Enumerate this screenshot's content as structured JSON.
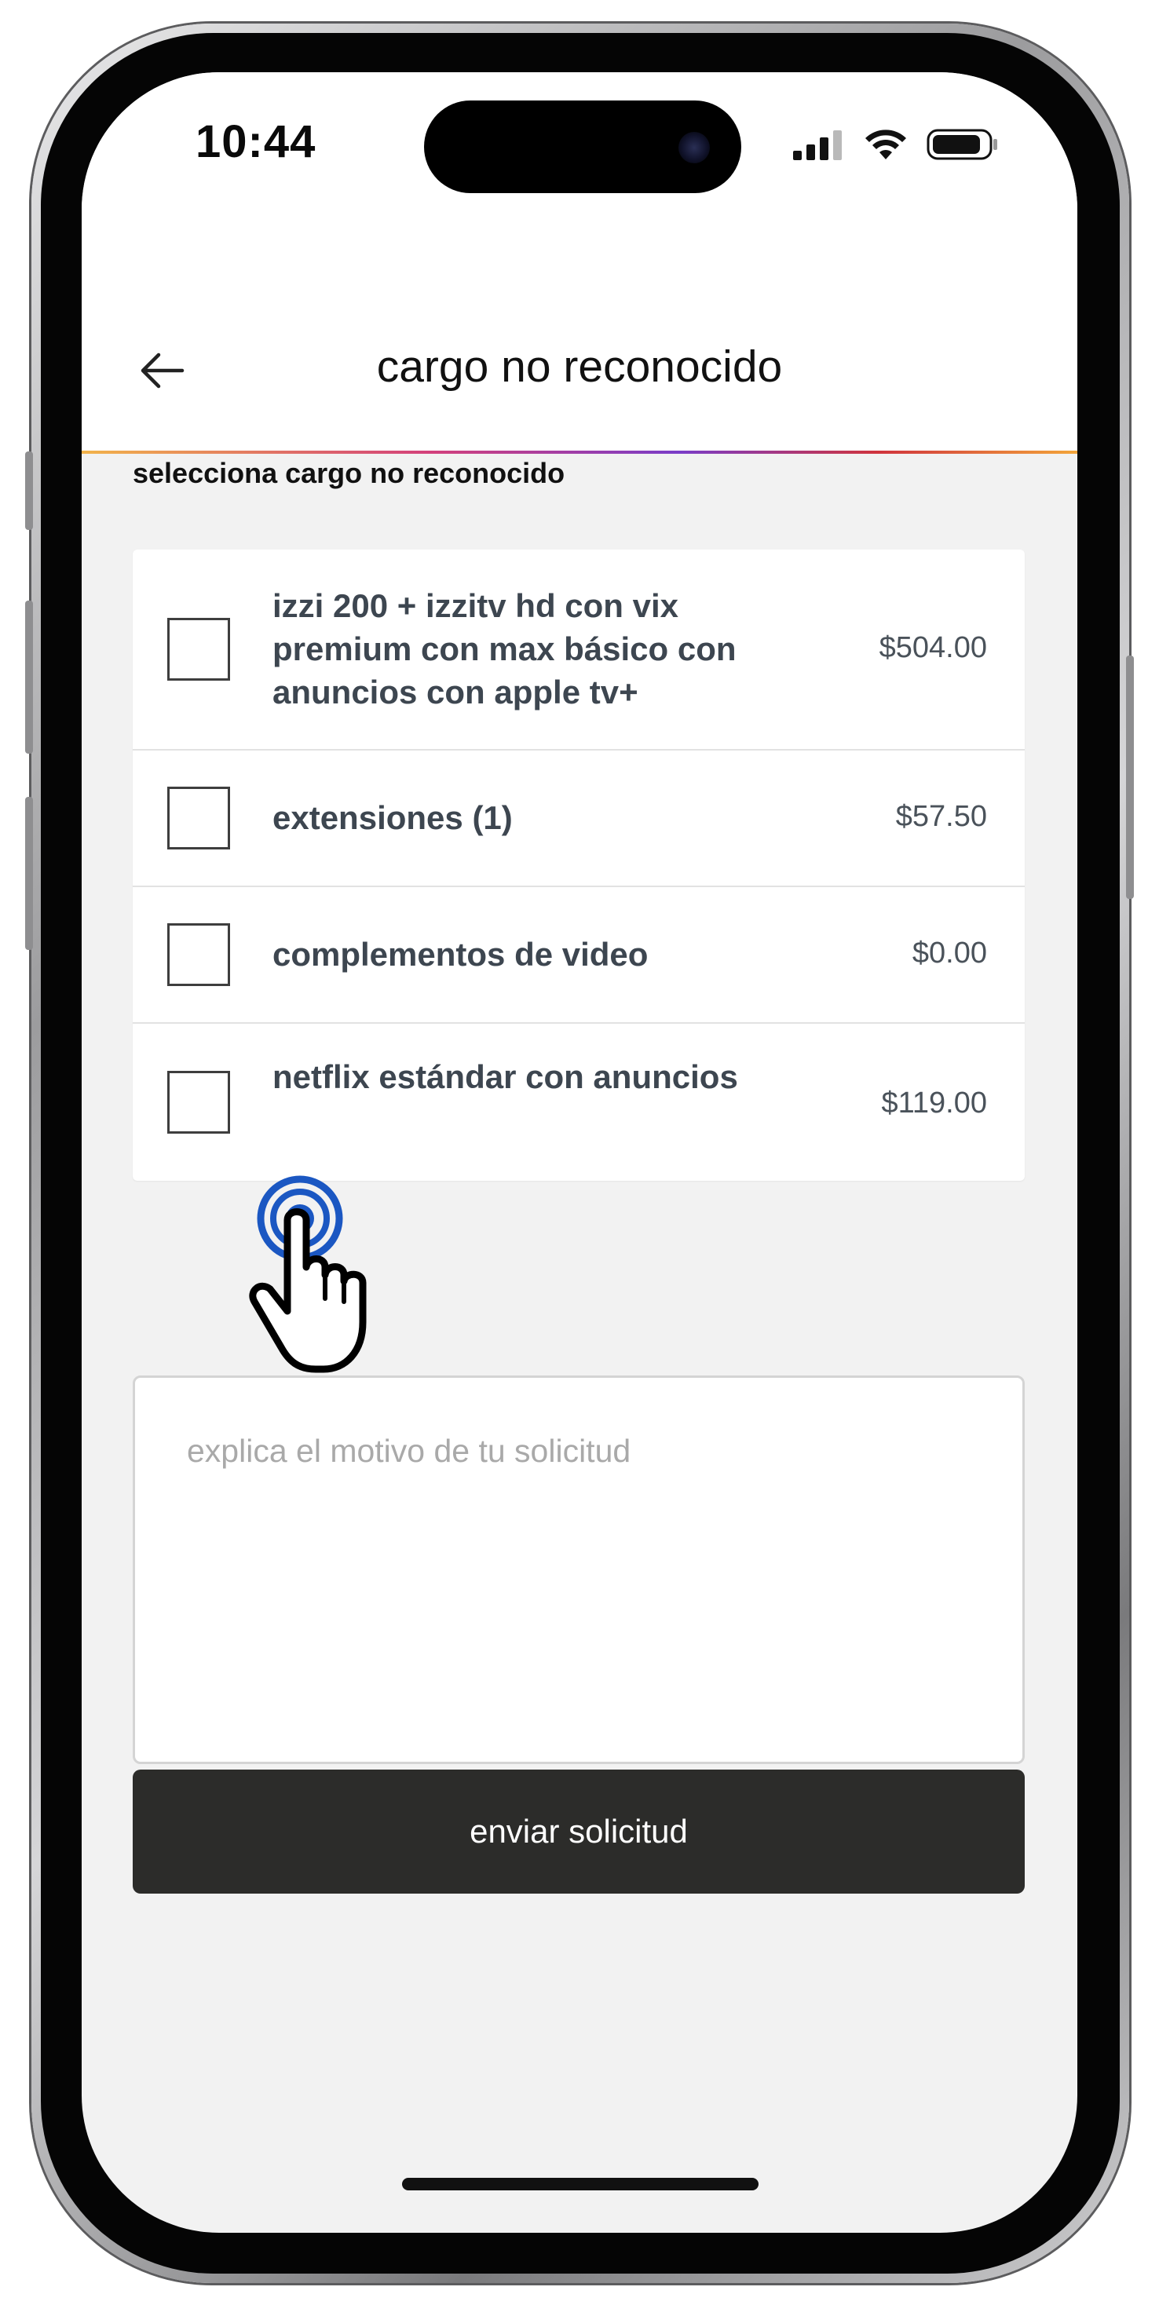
{
  "status_bar": {
    "time": "10:44",
    "icons": [
      "signal-icon",
      "wifi-icon",
      "battery-icon"
    ]
  },
  "header": {
    "title": "cargo no reconocido",
    "back_icon": "arrow-left-icon"
  },
  "section": {
    "label": "selecciona cargo no reconocido"
  },
  "charges": [
    {
      "description": "izzi 200 + izzitv hd con vix premium con max básico con anuncios con apple tv+",
      "amount": "$504.00",
      "checked": false
    },
    {
      "description": "extensiones (1)",
      "amount": "$57.50",
      "checked": false
    },
    {
      "description": "complementos de video",
      "amount": "$0.00",
      "checked": false
    },
    {
      "description": "netflix estándar con anuncios",
      "amount": "$119.00",
      "checked": false
    }
  ],
  "reason": {
    "placeholder": "explica el motivo de tu solicitud",
    "value": ""
  },
  "submit": {
    "label": "enviar solicitud"
  },
  "overlay": {
    "icon": "tap-hand-icon",
    "ripple_color": "#1b57c2"
  },
  "colors": {
    "button_bg": "#2c2c2a",
    "background": "#f2f2f2",
    "text_dark": "#3d4650"
  }
}
